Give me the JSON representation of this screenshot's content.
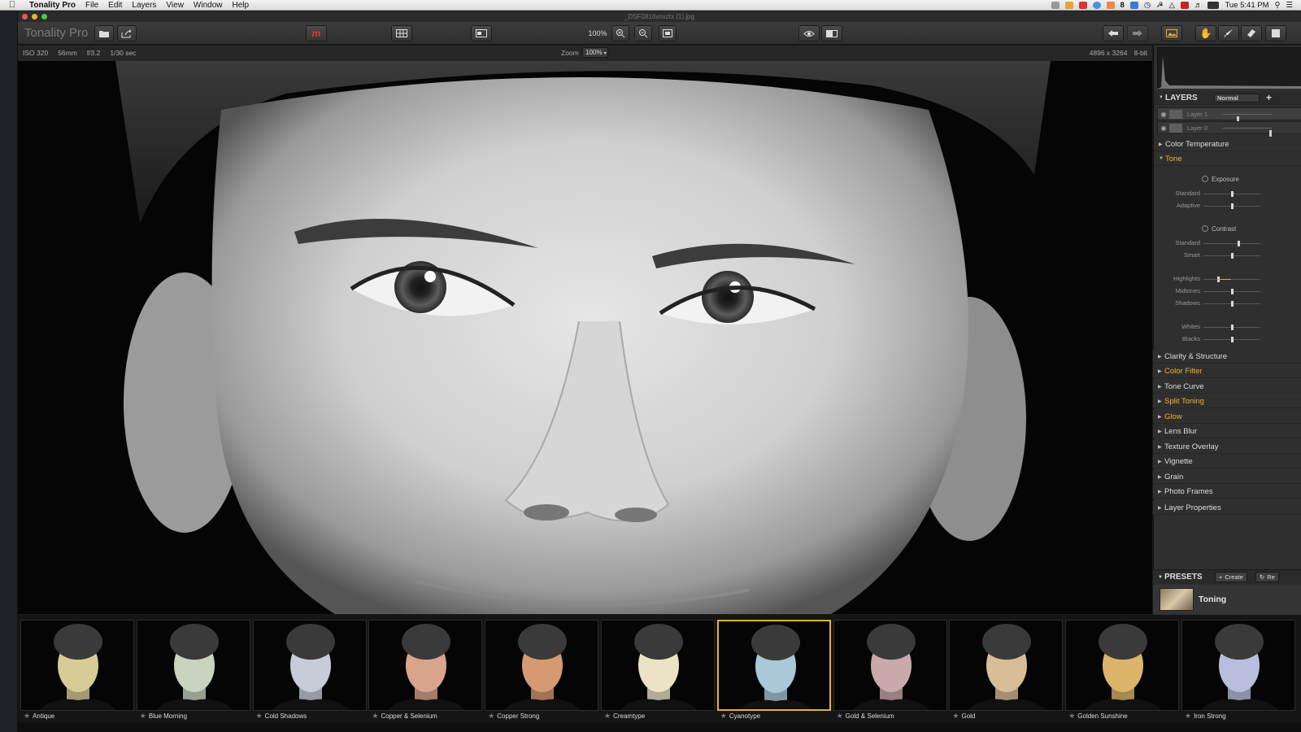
{
  "menubar": {
    "app_name": "Tonality Pro",
    "items": [
      "File",
      "Edit",
      "Layers",
      "View",
      "Window",
      "Help"
    ],
    "status_text": "8",
    "clock": "Tue 5:41 PM"
  },
  "window": {
    "file_title": "_DSF0816vnxztx (1).jpg"
  },
  "toolbar": {
    "app_title": "Tonality Pro",
    "zoom_value": "100%"
  },
  "infobar": {
    "iso": "ISO 320",
    "focal": "56mm",
    "aperture": "f/3.2",
    "shutter": "1/30 sec",
    "zoom_label": "Zoom",
    "zoom_select": "100%",
    "dimensions": "4896 x 3264",
    "bitdepth": "8-bit"
  },
  "layers_panel": {
    "title": "LAYERS",
    "blend_mode": "Normal",
    "add_symbol": "+",
    "layers": [
      {
        "name": "Layer 1",
        "opacity": 0.3
      },
      {
        "name": "Layer 0",
        "opacity": 1.0
      }
    ]
  },
  "adjustments": {
    "color_temperature": "Color Temperature",
    "tone": "Tone",
    "exposure_title": "Exposure",
    "exposure_standard": "Standard",
    "exposure_adaptive": "Adaptive",
    "contrast_title": "Contrast",
    "contrast_standard": "Standard",
    "contrast_smart": "Smart",
    "highlights": "Highlights",
    "midtones": "Midtones",
    "shadows": "Shadows",
    "whites": "Whites",
    "blacks": "Blacks",
    "sections": [
      {
        "label": "Clarity & Structure",
        "active": false
      },
      {
        "label": "Color Filter",
        "active": true
      },
      {
        "label": "Tone Curve",
        "active": false
      },
      {
        "label": "Split Toning",
        "active": true
      },
      {
        "label": "Glow",
        "active": true
      },
      {
        "label": "Lens Blur",
        "active": false
      },
      {
        "label": "Texture Overlay",
        "active": false
      },
      {
        "label": "Vignette",
        "active": false
      },
      {
        "label": "Grain",
        "active": false
      },
      {
        "label": "Photo Frames",
        "active": false
      },
      {
        "label": "Layer Properties",
        "active": false
      }
    ],
    "slider_values": {
      "exposure_standard": 0.5,
      "exposure_adaptive": 0.5,
      "contrast_standard": 0.62,
      "contrast_smart": 0.5,
      "highlights": 0.25,
      "midtones": 0.5,
      "shadows": 0.5,
      "whites": 0.5,
      "blacks": 0.5
    }
  },
  "presets": {
    "title": "PRESETS",
    "create_label": "Create",
    "refresh_label": "Re",
    "category": "Toning"
  },
  "filmstrip": {
    "items": [
      {
        "label": "Antique",
        "tint": "#d8cc96",
        "selected": false
      },
      {
        "label": "Blue Morning",
        "tint": "#c9d3c0",
        "selected": false
      },
      {
        "label": "Cold Shadows",
        "tint": "#c7ccd8",
        "selected": false
      },
      {
        "label": "Copper & Selenium",
        "tint": "#d8a48c",
        "selected": false
      },
      {
        "label": "Copper Strong",
        "tint": "#d59a72",
        "selected": false
      },
      {
        "label": "Creamtype",
        "tint": "#ece3c5",
        "selected": false
      },
      {
        "label": "Cyanotype",
        "tint": "#a9c8d8",
        "selected": true
      },
      {
        "label": "Gold & Selenium",
        "tint": "#c9a9a9",
        "selected": false
      },
      {
        "label": "Gold",
        "tint": "#d7bd98",
        "selected": false
      },
      {
        "label": "Golden Sunshine",
        "tint": "#dcb56a",
        "selected": false
      },
      {
        "label": "Iron Strong",
        "tint": "#b8bfdc",
        "selected": false
      }
    ]
  }
}
